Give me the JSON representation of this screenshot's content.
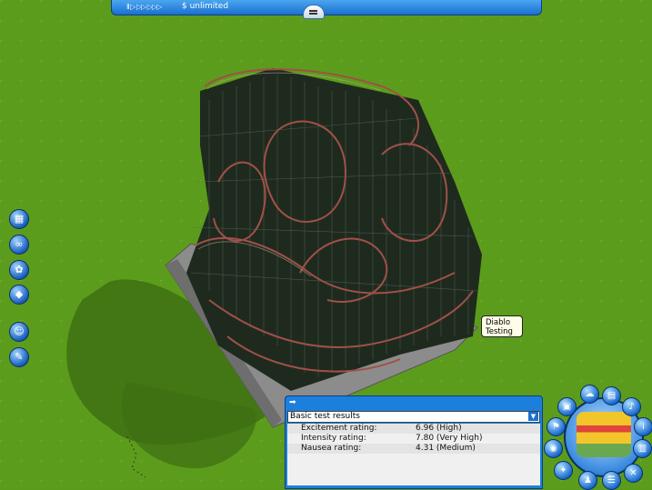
{
  "topbar": {
    "controls": "II ▷ ▷▷ ▷▷▷",
    "money": "$ unlimited"
  },
  "left_toolbar": {
    "items": [
      {
        "icon": "landscape-icon"
      },
      {
        "icon": "rides-icon"
      },
      {
        "icon": "scenery-icon"
      },
      {
        "icon": "paths-icon"
      },
      {
        "icon": "park-management-icon"
      },
      {
        "icon": "staff-icon"
      }
    ]
  },
  "tooltip": {
    "line1": "Diablo",
    "line2": "Testing"
  },
  "results_panel": {
    "dropdown_value": "Basic test results",
    "rows": [
      {
        "label": "Excitement rating:",
        "value": "6.96 (High)"
      },
      {
        "label": "Intensity rating:",
        "value": "7.80 (Very High)"
      },
      {
        "label": "Nausea rating:",
        "value": "4.31 (Medium)"
      }
    ]
  },
  "right_menu": {
    "buttons": [
      {
        "icon": "photo-icon"
      },
      {
        "icon": "thought-bubble-icon"
      },
      {
        "icon": "monitor-icon"
      },
      {
        "icon": "bell-icon"
      },
      {
        "icon": "flag-icon"
      },
      {
        "icon": "info-icon"
      },
      {
        "icon": "camera-icon"
      },
      {
        "icon": "map-icon"
      },
      {
        "icon": "wrench-icon"
      },
      {
        "icon": "person-icon"
      },
      {
        "icon": "close-icon"
      }
    ]
  }
}
